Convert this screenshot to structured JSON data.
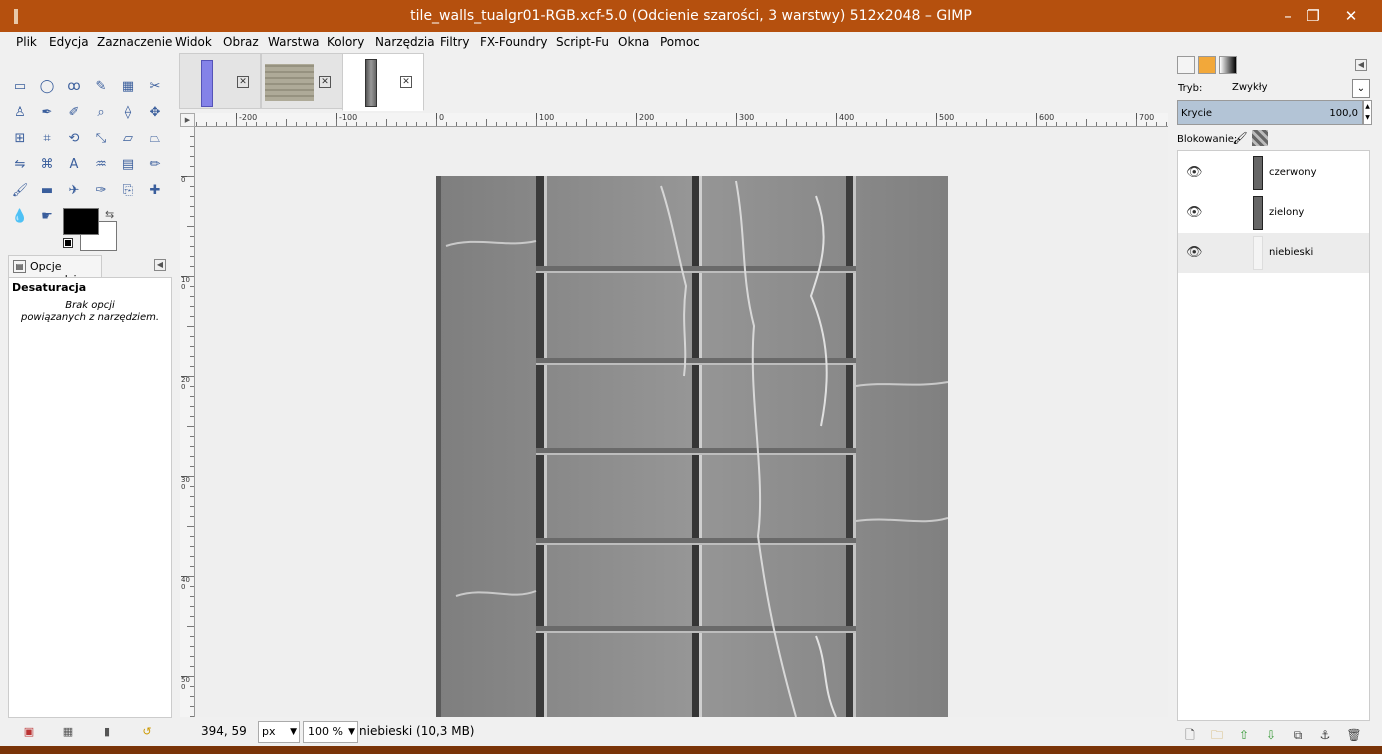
{
  "window": {
    "title": "tile_walls_tualgr01-RGB.xcf-5.0 (Odcienie szarości, 3 warstwy) 512x2048 – GIMP",
    "minimize_glyph": "–",
    "restore_glyph": "❐",
    "close_glyph": "✕"
  },
  "menu": [
    "Plik",
    "Edycja",
    "Zaznaczenie",
    "Widok",
    "Obraz",
    "Warstwa",
    "Kolory",
    "Narzędzia",
    "Filtry",
    "FX-Foundry",
    "Script-Fu",
    "Okna",
    "Pomoc"
  ],
  "toolbox": {
    "tools": [
      {
        "icon": "rect-select-icon",
        "glyph": "▭"
      },
      {
        "icon": "ellipse-select-icon",
        "glyph": "◯"
      },
      {
        "icon": "free-select-icon",
        "glyph": "ꝏ"
      },
      {
        "icon": "fuzzy-select-icon",
        "glyph": "✎"
      },
      {
        "icon": "select-by-color-icon",
        "glyph": "▦"
      },
      {
        "icon": "scissors-icon",
        "glyph": "✂"
      },
      {
        "icon": "foreground-select-icon",
        "glyph": "♙"
      },
      {
        "icon": "paths-icon",
        "glyph": "✒"
      },
      {
        "icon": "color-picker-icon",
        "glyph": "✐"
      },
      {
        "icon": "zoom-icon",
        "glyph": "⌕"
      },
      {
        "icon": "measure-icon",
        "glyph": "⟠"
      },
      {
        "icon": "move-icon",
        "glyph": "✥"
      },
      {
        "icon": "align-icon",
        "glyph": "⊞"
      },
      {
        "icon": "crop-icon",
        "glyph": "⌗"
      },
      {
        "icon": "rotate-icon",
        "glyph": "⟲"
      },
      {
        "icon": "scale-icon",
        "glyph": "⤡"
      },
      {
        "icon": "shear-icon",
        "glyph": "▱"
      },
      {
        "icon": "perspective-icon",
        "glyph": "⏢"
      },
      {
        "icon": "flip-icon",
        "glyph": "⇋"
      },
      {
        "icon": "cage-icon",
        "glyph": "⌘"
      },
      {
        "icon": "text-icon",
        "glyph": "A"
      },
      {
        "icon": "bucket-fill-icon",
        "glyph": "♒"
      },
      {
        "icon": "blend-icon",
        "glyph": "▤"
      },
      {
        "icon": "pencil-icon",
        "glyph": "✏"
      },
      {
        "icon": "paintbrush-icon",
        "glyph": "🖌"
      },
      {
        "icon": "eraser-icon",
        "glyph": "▬"
      },
      {
        "icon": "airbrush-icon",
        "glyph": "✈"
      },
      {
        "icon": "ink-icon",
        "glyph": "✑"
      },
      {
        "icon": "clone-icon",
        "glyph": "⎘"
      },
      {
        "icon": "heal-icon",
        "glyph": "✚"
      },
      {
        "icon": "blur-icon",
        "glyph": "💧"
      },
      {
        "icon": "smudge-icon",
        "glyph": "☛"
      },
      {
        "icon": "dodge-burn-icon",
        "glyph": "●"
      }
    ],
    "fg_color": "#000000",
    "bg_color": "#ffffff",
    "options_tab_label": "Opcje narzędzia",
    "options_title": "Desaturacja",
    "options_msg_line1": "Brak opcji",
    "options_msg_line2": "powiązanych z narzędziem.",
    "bottom_icons": [
      "save-options-icon",
      "restore-options-icon",
      "delete-options-icon",
      "reset-options-icon"
    ]
  },
  "image_tabs": [
    {
      "name": "image-tab-1",
      "thumb": "blue-strip-icon",
      "close": "✕"
    },
    {
      "name": "image-tab-2",
      "thumb": "wall-texture-icon",
      "close": "✕"
    },
    {
      "name": "image-tab-3",
      "thumb": "gray-strip-icon",
      "close": "✕",
      "active": true
    }
  ],
  "rulers": {
    "horizontal": [
      "-200",
      "-100",
      "0",
      "100",
      "200",
      "300",
      "400",
      "500",
      "600",
      "700"
    ],
    "vertical": [
      "0",
      "100",
      "200",
      "300",
      "400",
      "500"
    ]
  },
  "statusbar": {
    "coords": "394, 59",
    "unit": "px",
    "zoom": "100 %",
    "message": "niebieski (10,3 MB)"
  },
  "dock": {
    "mode_label": "Tryb:",
    "mode_value": "Zwykły",
    "opacity_label": "Krycie",
    "opacity_value": "100,0",
    "lock_label": "Blokowanie:",
    "layers": [
      {
        "name": "czerwony",
        "visible": true,
        "thumb": "dark"
      },
      {
        "name": "zielony",
        "visible": true,
        "thumb": "dark"
      },
      {
        "name": "niebieski",
        "visible": true,
        "thumb": "light",
        "active": true
      }
    ],
    "bottom_icons": [
      "new-layer-icon",
      "new-layer-group-icon",
      "raise-layer-icon",
      "lower-layer-icon",
      "duplicate-layer-icon",
      "anchor-layer-icon",
      "delete-layer-icon"
    ]
  }
}
